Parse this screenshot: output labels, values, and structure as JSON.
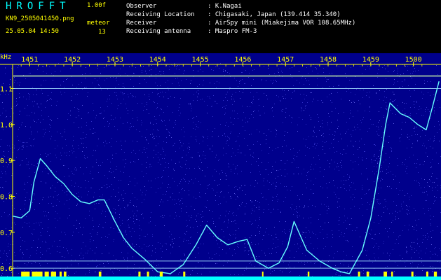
{
  "header": {
    "app_title": "HROFFT",
    "version": "1.00f",
    "filename": "KN9_2505041450.png",
    "meteor_label": "meteor",
    "meteor_count": "13",
    "datetime": "25.05.04 14:50",
    "info": [
      {
        "key": "Observer",
        "value": ": K.Nagai"
      },
      {
        "key": "Receiving Location",
        "value": ": Chigasaki, Japan (139.414 35.340)"
      },
      {
        "key": "Receiver",
        "value": ": AirSpy mini (Miakejima VOR 108.65MHz)"
      },
      {
        "key": "Receiving antenna",
        "value": ": Maspro FM-3"
      }
    ]
  },
  "colors": {
    "background": "#00008c",
    "axis_text": "#ffff00",
    "trace": "#66ffff",
    "detect_bar": "#ffff00",
    "baseline": "#00ffff"
  },
  "chart_data": {
    "type": "heatmap",
    "y_unit": "kHz",
    "time_ticks": [
      "1451",
      "1452",
      "1453",
      "1454",
      "1455",
      "1456",
      "1457",
      "1458",
      "1459",
      "1500"
    ],
    "freq_ticks": [
      "1.1",
      "1.0",
      "0.9",
      "0.8",
      "0.7",
      "0.6"
    ],
    "xlim": [
      1450.6,
      1500.4
    ],
    "ylim": [
      0.575,
      1.175
    ],
    "carrier_lines_khz": [
      1.135,
      1.1,
      0.62,
      0.6
    ],
    "trace": [
      [
        1450.6,
        0.745
      ],
      [
        1450.8,
        0.74
      ],
      [
        1451.0,
        0.76
      ],
      [
        1451.1,
        0.84
      ],
      [
        1451.25,
        0.905
      ],
      [
        1451.4,
        0.885
      ],
      [
        1451.6,
        0.855
      ],
      [
        1451.8,
        0.835
      ],
      [
        1452.0,
        0.805
      ],
      [
        1452.2,
        0.785
      ],
      [
        1452.4,
        0.78
      ],
      [
        1452.6,
        0.79
      ],
      [
        1452.75,
        0.79
      ],
      [
        1453.0,
        0.73
      ],
      [
        1453.2,
        0.685
      ],
      [
        1453.4,
        0.655
      ],
      [
        1453.7,
        0.625
      ],
      [
        1454.0,
        0.59
      ],
      [
        1454.3,
        0.585
      ],
      [
        1454.6,
        0.61
      ],
      [
        1454.9,
        0.665
      ],
      [
        1455.15,
        0.72
      ],
      [
        1455.4,
        0.685
      ],
      [
        1455.65,
        0.665
      ],
      [
        1455.9,
        0.675
      ],
      [
        1456.1,
        0.68
      ],
      [
        1456.3,
        0.62
      ],
      [
        1456.6,
        0.6
      ],
      [
        1456.85,
        0.615
      ],
      [
        1457.05,
        0.66
      ],
      [
        1457.2,
        0.73
      ],
      [
        1457.5,
        0.65
      ],
      [
        1457.8,
        0.62
      ],
      [
        1458.1,
        0.6
      ],
      [
        1458.3,
        0.59
      ],
      [
        1458.5,
        0.585
      ],
      [
        1458.8,
        0.65
      ],
      [
        1459.0,
        0.74
      ],
      [
        1459.2,
        0.88
      ],
      [
        1459.35,
        1.0
      ],
      [
        1459.45,
        1.06
      ],
      [
        1459.7,
        1.03
      ],
      [
        1459.9,
        1.02
      ],
      [
        1460.1,
        1.0
      ],
      [
        1460.3,
        0.985
      ],
      [
        1460.45,
        1.05
      ],
      [
        1460.6,
        1.12
      ]
    ],
    "detections": [
      [
        1450.8,
        1451.0
      ],
      [
        1451.05,
        1451.3
      ],
      [
        1451.35,
        1451.45
      ],
      [
        1451.5,
        1451.62
      ],
      [
        1451.7,
        1451.75
      ],
      [
        1451.8,
        1451.86
      ],
      [
        1452.62,
        1452.68
      ],
      [
        1453.55,
        1453.6
      ],
      [
        1453.75,
        1453.8
      ],
      [
        1454.05,
        1454.12
      ],
      [
        1454.6,
        1454.65
      ],
      [
        1456.45,
        1456.48
      ],
      [
        1457.52,
        1457.56
      ],
      [
        1458.7,
        1458.75
      ],
      [
        1458.9,
        1458.96
      ],
      [
        1459.3,
        1459.38
      ],
      [
        1459.48,
        1459.52
      ],
      [
        1459.95,
        1460.0
      ],
      [
        1460.3,
        1460.35
      ],
      [
        1460.48,
        1460.55
      ]
    ]
  }
}
